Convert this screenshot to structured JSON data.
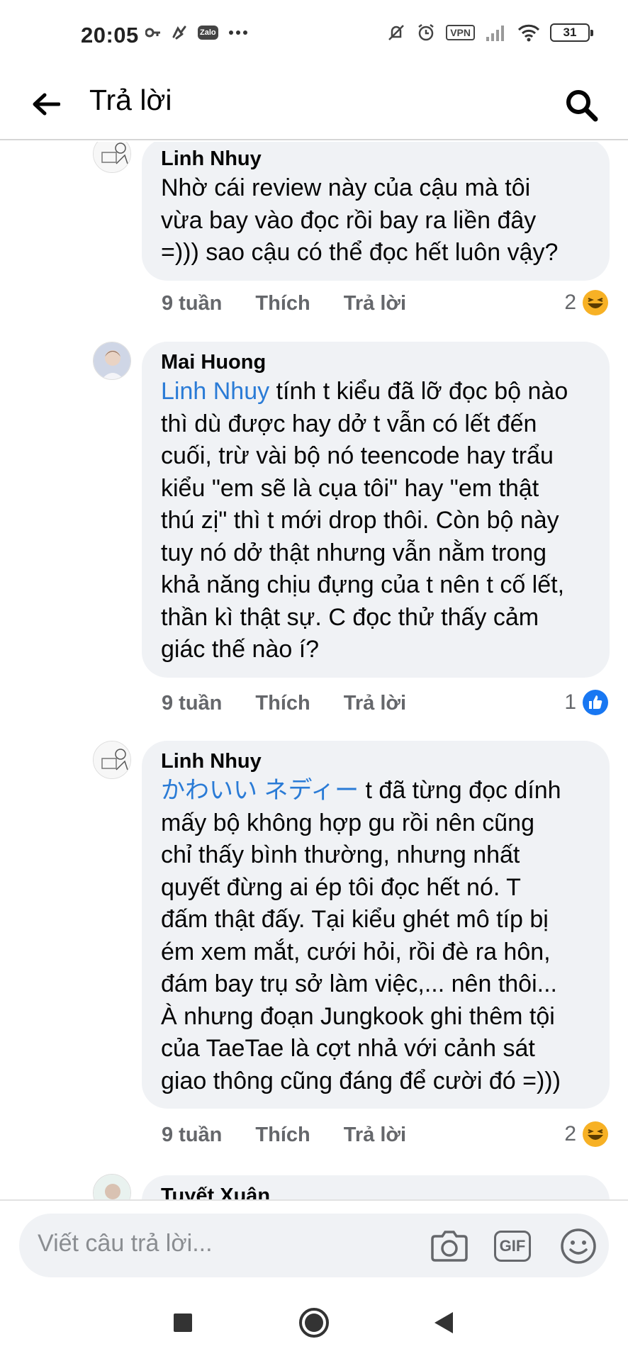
{
  "status_bar": {
    "time": "20:05",
    "zalo_label": "Zalo",
    "vpn_label": "VPN",
    "battery": "31"
  },
  "header": {
    "title": "Trả lời"
  },
  "comments": [
    {
      "author": "Linh Nhuy",
      "mention": "",
      "text": "Nhờ cái review này của cậu mà tôi\nvừa bay vào đọc rồi bay ra liền đây\n=))) sao cậu có thể đọc hết luôn vậy?",
      "time": "9 tuần",
      "like_label": "Thích",
      "reply_label": "Trả lời",
      "reaction_count": "2",
      "reaction_type": "haha-icon"
    },
    {
      "author": "Mai Huong",
      "mention": "Linh Nhuy",
      "text": " tính t kiểu đã lỡ đọc bộ nào\nthì dù  được hay dở t vẫn có lết đến\ncuối, trừ vài bộ nó teencode hay trẩu\nkiểu \"em sẽ là cụa tôi\" hay \"em thật\nthú zị\" thì t mới drop thôi. Còn bộ này\ntuy nó dở thật nhưng vẫn nằm trong\nkhả năng chịu đựng của t nên t cố lết,\nthần kì thật sự. C đọc thử thấy cảm\ngiác thế nào í?",
      "time": "9 tuần",
      "like_label": "Thích",
      "reply_label": "Trả lời",
      "reaction_count": "1",
      "reaction_type": "like-icon"
    },
    {
      "author": "Linh Nhuy",
      "mention": "かわいい ネディー",
      "text": " t đã từng đọc dính\nmấy bộ không hợp gu rồi nên cũng\nchỉ thấy bình thường, nhưng nhất\nquyết đừng ai ép tôi đọc hết nó. T\nđấm thật đấy. Tại kiểu ghét mô típ bị\ném xem mắt, cưới hỏi, rồi đè ra hôn,\nđám bay trụ sở làm việc,... nên thôi...\nÀ nhưng đoạn Jungkook ghi thêm tội\ncủa TaeTae là cợt nhả với cảnh sát\ngiao thông cũng đáng để cười đó =)))",
      "time": "9 tuần",
      "like_label": "Thích",
      "reply_label": "Trả lời",
      "reaction_count": "2",
      "reaction_type": "haha-icon"
    },
    {
      "author": "Tuyết Xuân"
    }
  ],
  "composer": {
    "placeholder": "Viết câu trả lời...",
    "gif_label": "GIF"
  },
  "colors": {
    "link": "#2a7bd6",
    "bubble_bg": "#f0f2f5",
    "meta_text": "#65676b",
    "like_blue": "#1877f2",
    "haha_yellow": "#f7b125"
  }
}
